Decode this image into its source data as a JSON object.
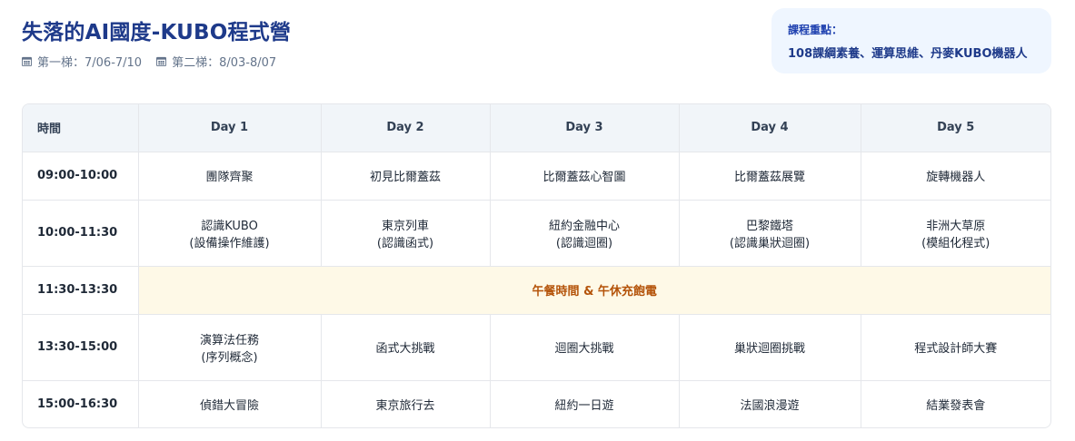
{
  "header": {
    "title": "失落的AI國度-KUBO程式營",
    "dates": [
      {
        "icon": "calendar-icon",
        "label": "第一梯：7/06-7/10"
      },
      {
        "icon": "calendar-icon",
        "label": "第二梯：8/03-8/07"
      }
    ]
  },
  "focus": {
    "label": "課程重點：",
    "text": "108課綱素養、運算思維、丹麥KUBO機器人"
  },
  "schedule": {
    "columns": [
      "時間",
      "Day 1",
      "Day 2",
      "Day 3",
      "Day 4",
      "Day 5"
    ],
    "rows": [
      {
        "time": "09:00-10:00",
        "cells": [
          {
            "line1": "團隊齊聚",
            "line2": ""
          },
          {
            "line1": "初見比爾蓋茲",
            "line2": ""
          },
          {
            "line1": "比爾蓋茲心智圖",
            "line2": ""
          },
          {
            "line1": "比爾蓋茲展覽",
            "line2": ""
          },
          {
            "line1": "旋轉機器人",
            "line2": ""
          }
        ]
      },
      {
        "time": "10:00-11:30",
        "cells": [
          {
            "line1": "認識KUBO",
            "line2": "(設備操作維護)"
          },
          {
            "line1": "東京列車",
            "line2": "(認識函式)"
          },
          {
            "line1": "紐約金融中心",
            "line2": "(認識迴圈)"
          },
          {
            "line1": "巴黎鐵塔",
            "line2": "(認識巢狀迴圈)"
          },
          {
            "line1": "非洲大草原",
            "line2": "(模組化程式)"
          }
        ]
      },
      {
        "time": "11:30-13:30",
        "lunch": "午餐時間 & 午休充飽電"
      },
      {
        "time": "13:30-15:00",
        "cells": [
          {
            "line1": "演算法任務",
            "line2": "(序列概念)"
          },
          {
            "line1": "函式大挑戰",
            "line2": ""
          },
          {
            "line1": "迴圈大挑戰",
            "line2": ""
          },
          {
            "line1": "巢狀迴圈挑戰",
            "line2": ""
          },
          {
            "line1": "程式設計師大賽",
            "line2": ""
          }
        ]
      },
      {
        "time": "15:00-16:30",
        "cells": [
          {
            "line1": "偵錯大冒險",
            "line2": ""
          },
          {
            "line1": "東京旅行去",
            "line2": ""
          },
          {
            "line1": "紐約一日遊",
            "line2": ""
          },
          {
            "line1": "法國浪漫遊",
            "line2": ""
          },
          {
            "line1": "結業發表會",
            "line2": ""
          }
        ]
      }
    ]
  }
}
